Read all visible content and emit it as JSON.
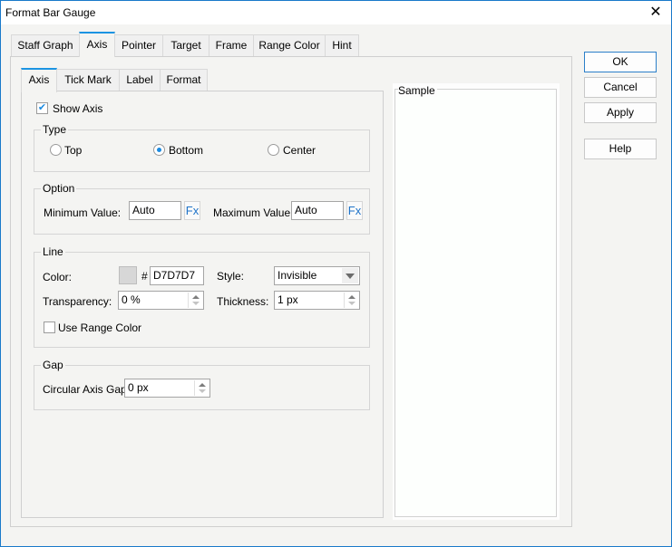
{
  "window": {
    "title": "Format Bar Gauge",
    "close_icon": "close-x"
  },
  "tabs": [
    {
      "label": "Staff Graph",
      "active": false
    },
    {
      "label": "Axis",
      "active": true
    },
    {
      "label": "Pointer",
      "active": false
    },
    {
      "label": "Target",
      "active": false
    },
    {
      "label": "Frame",
      "active": false
    },
    {
      "label": "Range Color",
      "active": false
    },
    {
      "label": "Hint",
      "active": false
    }
  ],
  "subtabs": [
    {
      "label": "Axis",
      "active": true
    },
    {
      "label": "Tick Mark",
      "active": false
    },
    {
      "label": "Label",
      "active": false
    },
    {
      "label": "Format",
      "active": false
    }
  ],
  "show_axis": {
    "label": "Show Axis",
    "checked": true
  },
  "type_group": {
    "label": "Type",
    "options": [
      {
        "label": "Top",
        "selected": false
      },
      {
        "label": "Bottom",
        "selected": true
      },
      {
        "label": "Center",
        "selected": false
      }
    ]
  },
  "option_group": {
    "label": "Option",
    "min_label": "Minimum Value:",
    "min_value": "Auto",
    "max_label": "Maximum Value:",
    "max_value": "Auto",
    "fx_label": "Fx"
  },
  "line_group": {
    "label": "Line",
    "color_label": "Color:",
    "color_hash": "#",
    "color_value": "D7D7D7",
    "color_swatch": "#d7d7d7",
    "style_label": "Style:",
    "style_value": "Invisible",
    "transparency_label": "Transparency:",
    "transparency_value": "0 %",
    "thickness_label": "Thickness:",
    "thickness_value": "1 px",
    "use_range_color_label": "Use Range Color",
    "use_range_color_checked": false
  },
  "gap_group": {
    "label": "Gap",
    "circular_gap_label": "Circular Axis Gap:",
    "circular_gap_value": "0 px"
  },
  "sample": {
    "label": "Sample"
  },
  "buttons": {
    "ok": "OK",
    "cancel": "Cancel",
    "apply": "Apply",
    "help": "Help"
  },
  "colors": {
    "accent": "#1c8be0",
    "window_border": "#1979ca",
    "fx_text": "#1f73c8"
  }
}
